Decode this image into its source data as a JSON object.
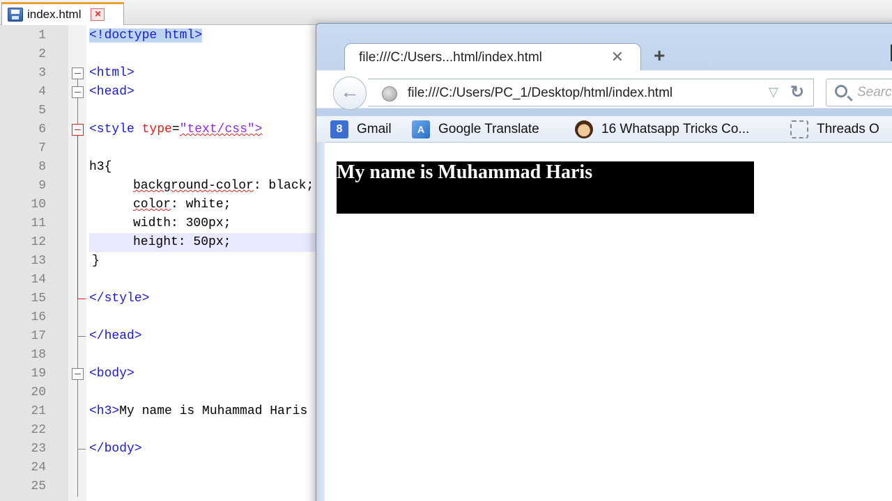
{
  "editor": {
    "tab_label": "index.html",
    "lines": [
      {
        "num": "1"
      },
      {
        "num": "2"
      },
      {
        "num": "3"
      },
      {
        "num": "4"
      },
      {
        "num": "5"
      },
      {
        "num": "6"
      },
      {
        "num": "7"
      },
      {
        "num": "8"
      },
      {
        "num": "9"
      },
      {
        "num": "10"
      },
      {
        "num": "11"
      },
      {
        "num": "12"
      },
      {
        "num": "13"
      },
      {
        "num": "14"
      },
      {
        "num": "15"
      },
      {
        "num": "16"
      },
      {
        "num": "17"
      },
      {
        "num": "18"
      },
      {
        "num": "19"
      },
      {
        "num": "20"
      },
      {
        "num": "21"
      },
      {
        "num": "22"
      },
      {
        "num": "23"
      },
      {
        "num": "24"
      },
      {
        "num": "25"
      }
    ],
    "code": {
      "l1": "<!doctype html>",
      "l3": "<html>",
      "l4": "<head>",
      "l6_tag": "<style ",
      "l6_attr": "type",
      "l6_eq": "=",
      "l6_str": "\"text/css\">",
      "l8": "h3{",
      "l9_prop": "background-color",
      "l9_rest": ": black;",
      "l10_prop": "color",
      "l10_rest": ": white;",
      "l11": "width: 300px;",
      "l12": "height: 50px;",
      "l13": "}",
      "l15": "</style>",
      "l17": "</head>",
      "l19": "<body>",
      "l21_tag": "<h3>",
      "l21_text": "My name is Muhammad Haris",
      "l23": "</body>"
    }
  },
  "browser": {
    "tab_title": "file:///C:/Users...html/index.html",
    "tab_close": "✕",
    "new_tab": "+",
    "url": "file:///C:/Users/PC_1/Desktop/html/index.html",
    "url_dropdown": "▽",
    "reload": "↻",
    "search_placeholder": "Search",
    "bookmarks": [
      {
        "label": "Gmail",
        "icon": "gmail-icon",
        "glyph": "8"
      },
      {
        "label": "Google Translate",
        "icon": "translate-icon",
        "glyph": "A"
      },
      {
        "label": "16 Whatsapp Tricks Co...",
        "icon": "whatsapp-face-icon",
        "glyph": ""
      },
      {
        "label": "Threads O",
        "icon": "threads-page-icon",
        "glyph": ""
      }
    ],
    "page": {
      "h3_text": "My name is Muhammad Haris"
    }
  },
  "colors": {
    "h3_background": "#000000",
    "h3_text": "#ffffff",
    "tag": "#1a1ad6",
    "attribute": "#e0201e",
    "string": "#8a2be2"
  }
}
